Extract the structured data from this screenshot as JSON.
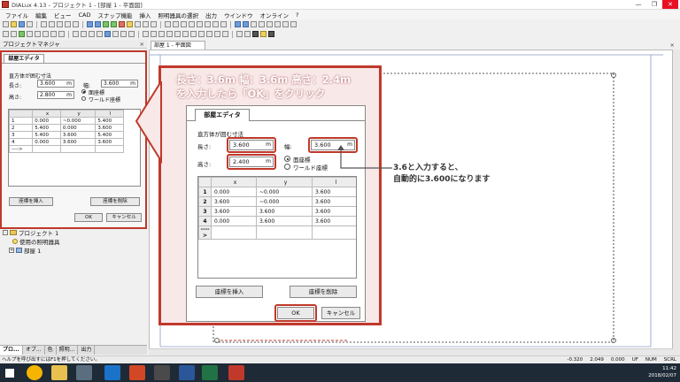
{
  "window": {
    "title": "DIALux 4.13 - プロジェクト 1 - [部屋 1 - 平面図]",
    "controls": [
      "—",
      "❐",
      "✕"
    ]
  },
  "menu": [
    "ファイル",
    "編集",
    "ビュー",
    "CAD",
    "スナップ機能",
    "挿入",
    "照明器具の選択",
    "出力",
    "ウインドウ",
    "オンライン",
    "?"
  ],
  "project_manager": {
    "title": "プロジェクトマネジャ",
    "close": "×"
  },
  "view_tab": {
    "label": "部屋 1 - 平面図",
    "close": "×"
  },
  "mini_editor": {
    "tab": "部屋エディタ",
    "section": "直方体が囲む寸法",
    "length_label": "長さ:",
    "length_value": "3.600",
    "length_unit": "m",
    "width_label": "幅:",
    "width_value": "3.600",
    "width_unit": "m",
    "height_label": "高さ:",
    "height_value": "2.800",
    "height_unit": "m",
    "radio_plane": "面座標",
    "radio_world": "ワールド座標",
    "columns": [
      "",
      "x",
      "y",
      "l"
    ],
    "rows": [
      [
        "1",
        "0.000",
        "~0.000",
        "5.400"
      ],
      [
        "2",
        "5.400",
        "0.000",
        "3.600"
      ],
      [
        "3",
        "5.400",
        "3.600",
        "5.400"
      ],
      [
        "4",
        "0.000",
        "3.600",
        "3.600"
      ],
      [
        "---->",
        "",
        "",
        ""
      ]
    ],
    "insert": "座標を挿入",
    "delete": "座標を削除",
    "ok": "OK",
    "cancel": "キャンセル"
  },
  "tree": {
    "project": "プロジェクト 1",
    "luminaires": "使用の照明器具",
    "room": "部屋 1"
  },
  "bottom_tabs": [
    "プロ...",
    "オブ...",
    "色",
    "照明...",
    "出力"
  ],
  "status": {
    "help": "ヘルプを呼び出すにはF1を押してください。",
    "x": "-0.320",
    "y": "2.049",
    "z": "0.000",
    "uf": "UF",
    "num": "NUM",
    "scrl": "SCRL"
  },
  "tray": {
    "time": "11:42",
    "date": "2018/02/07"
  },
  "overlay": {
    "line1": "長さ：3.6m 幅：3.6m 高さ：2.4m",
    "line2": "を入力したら「OK」をクリック"
  },
  "editor": {
    "tab": "部屋エディタ",
    "section": "直方体が囲む寸法",
    "length_label": "長さ:",
    "length_value": "3.600",
    "length_unit": "m",
    "width_label": "幅:",
    "width_value": "3.600",
    "width_unit": "m",
    "height_label": "高さ:",
    "height_value": "2.400",
    "height_unit": "m",
    "radio_plane": "面座標",
    "radio_world": "ワールド座標",
    "columns": [
      "",
      "x",
      "y",
      "l"
    ],
    "rows": [
      [
        "1",
        "0.000",
        "~0.000",
        "3.600"
      ],
      [
        "2",
        "3.600",
        "~0.000",
        "3.600"
      ],
      [
        "3",
        "3.600",
        "3.600",
        "3.600"
      ],
      [
        "4",
        "0.000",
        "3.600",
        "3.600"
      ],
      [
        "---->",
        "",
        "",
        ""
      ]
    ],
    "insert": "座標を挿入",
    "delete": "座標を削除",
    "ok": "OK",
    "cancel": "キャンセル"
  },
  "callout": {
    "line1": "3.6と入力すると、",
    "line2": "自動的に3.600になります"
  },
  "colors": {
    "accent": "#c0392b",
    "overlay_bg": "#f8e8e8"
  }
}
